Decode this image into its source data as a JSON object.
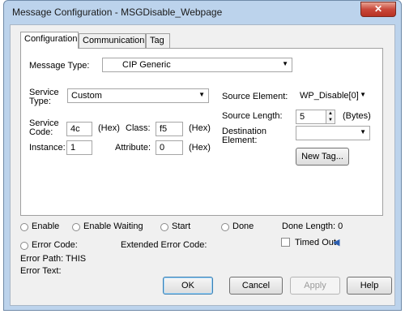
{
  "window": {
    "title": "Message Configuration - MSGDisable_Webpage",
    "close_glyph": "✕"
  },
  "tabs": [
    "Configuration",
    "Communication",
    "Tag"
  ],
  "config": {
    "message_type_label": "Message Type:",
    "message_type_value": "CIP Generic",
    "service_type_label_1": "Service",
    "service_type_label_2": "Type:",
    "service_type_value": "Custom",
    "service_code_label_1": "Service",
    "service_code_label_2": "Code:",
    "service_code_value": "4c",
    "hex1": "(Hex)",
    "class_label": "Class:",
    "class_value": "f5",
    "hex2": "(Hex)",
    "instance_label": "Instance:",
    "instance_value": "1",
    "attribute_label": "Attribute:",
    "attribute_value": "0",
    "hex3": "(Hex)",
    "source_element_label": "Source Element:",
    "source_element_value": "WP_Disable[0]",
    "source_length_label": "Source Length:",
    "source_length_value": "5",
    "bytes_label": "(Bytes)",
    "destination_label_1": "Destination",
    "destination_label_2": "Element:",
    "destination_value": "",
    "new_tag_button": "New Tag..."
  },
  "status": {
    "enable": "Enable",
    "enable_waiting": "Enable Waiting",
    "start": "Start",
    "done": "Done",
    "done_length": "Done Length: 0",
    "error_code": "Error Code:",
    "extended_error_code": "Extended Error Code:",
    "timed_out": "Timed Out",
    "error_path": "Error Path: THIS",
    "error_text": "Error Text:"
  },
  "buttons": {
    "ok": "OK",
    "cancel": "Cancel",
    "apply": "Apply",
    "help": "Help"
  }
}
